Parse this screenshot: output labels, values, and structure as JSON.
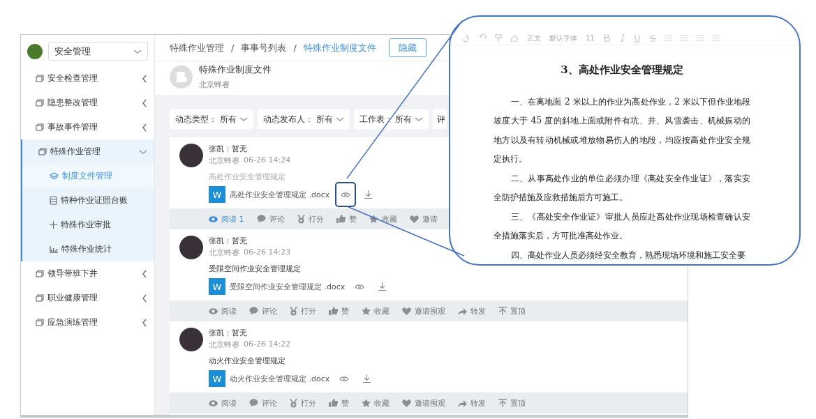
{
  "sidebar": {
    "module_select": "安全管理",
    "items": [
      {
        "label": "安全检查管理",
        "expanded": false
      },
      {
        "label": "隐患整改管理",
        "expanded": false
      },
      {
        "label": "事故事件管理",
        "expanded": false
      },
      {
        "label": "特殊作业管理",
        "expanded": true,
        "children": [
          {
            "label": "制度文件管理",
            "selected": true
          },
          {
            "label": "特种作业证照台账",
            "selected": false
          },
          {
            "label": "特殊作业审批",
            "selected": false
          },
          {
            "label": "特殊作业统计",
            "selected": false
          }
        ]
      },
      {
        "label": "领导带班下井",
        "expanded": false
      },
      {
        "label": "职业健康管理",
        "expanded": false
      },
      {
        "label": "应急演练管理",
        "expanded": false
      }
    ]
  },
  "breadcrumb": [
    "特殊作业管理",
    "/",
    "事事号列表",
    "/",
    "特殊作业制度文件"
  ],
  "hide_button": "隐藏",
  "header": {
    "title": "特殊作业制度文件",
    "subtitle": "北京蜂睿"
  },
  "filters": [
    {
      "label": "动态类型：",
      "value": "所有"
    },
    {
      "label": "动态发布人：",
      "value": "所有"
    },
    {
      "label": "工作表：",
      "value": "所有"
    },
    {
      "label": "评"
    }
  ],
  "posts": [
    {
      "author": "张凯：暂无",
      "org": "北京蜂睿",
      "time": "06-26 14:24",
      "description": "高处作业安全管理规定",
      "file_badge": "W",
      "file_name": "高处作业安全管理规定 .docx",
      "preview_highlighted": true,
      "read": true,
      "read_count": "1",
      "actions": [
        "阅读",
        "评论",
        "打分",
        "赞",
        "收藏",
        "邀请"
      ]
    },
    {
      "author": "张凯：暂无",
      "org": "北京蜂睿",
      "time": "06-26 14:23",
      "description": "受限空间作业安全管理规定",
      "file_badge": "W",
      "file_name": "受限空间作业安全管理规定 .docx",
      "preview_highlighted": false,
      "read": false,
      "actions": [
        "阅读",
        "评论",
        "打分",
        "赞",
        "收藏",
        "邀请围观",
        "转发",
        "置顶"
      ]
    },
    {
      "author": "张凯：暂无",
      "org": "北京蜂睿",
      "time": "06-26 14:22",
      "description": "动火作业安全管理规定",
      "file_badge": "W",
      "file_name": "动火作业安全管理规定 .docx",
      "preview_highlighted": false,
      "read": false,
      "actions": [
        "阅读",
        "评论",
        "打分",
        "赞",
        "收藏",
        "邀请围观",
        "转发",
        "置顶"
      ]
    }
  ],
  "callout": {
    "toolbar": [
      "正文",
      "默认字体",
      "11"
    ],
    "doc_title": "3、高处作业安全管理规定",
    "paragraphs": [
      "一、在离地面 2 米以上的作业为高处作业，2 米以下但作业地段坡度大于 45 度的斜地上面或附件有坑、井、风雪袭击、机械振动的地方以及有转动机械或堆放物易伤人的地段，均应按高处作业安全规定执行。",
      "二、从事高处作业的单位必须办理《高处安全作业证》，落实安全防护措施及应救措施后方可施工。",
      "三、《高处安全作业证》审批人员应赴高处作业现场检查确认安全措施落实后，方可批准高处作业。",
      "四、高处作业人员必须经安全教育，熟悉现场环境和施工安全要"
    ]
  }
}
